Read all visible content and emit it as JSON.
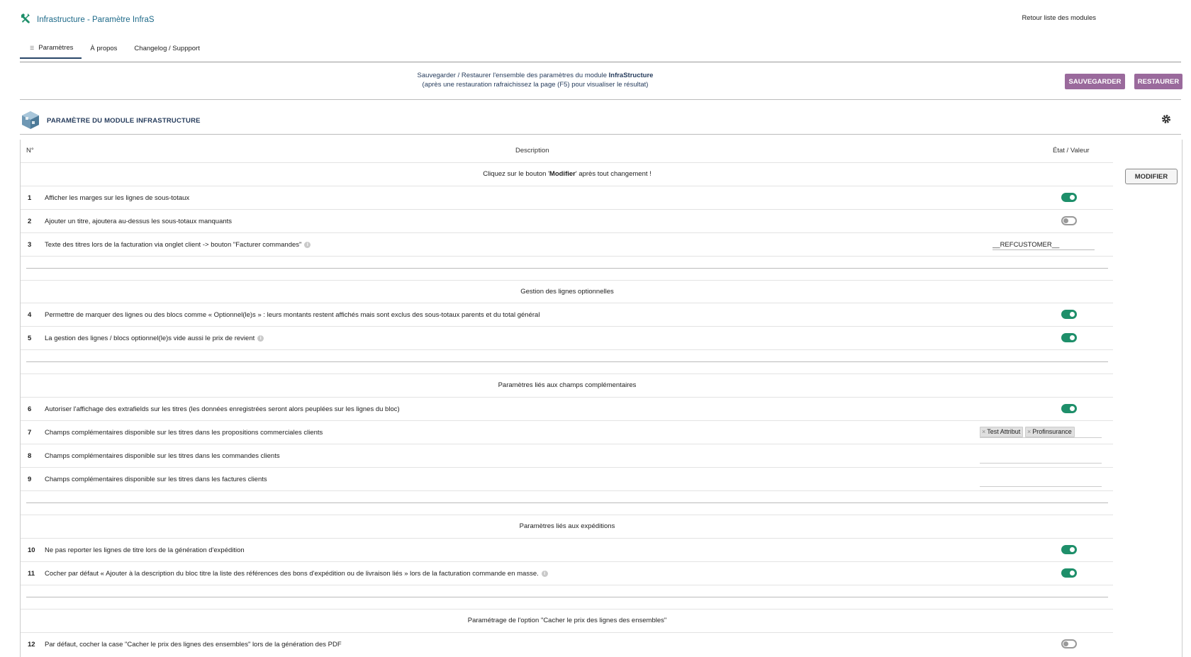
{
  "header": {
    "title": "Infrastructure - Paramètre InfraS",
    "back_link": "Retour liste des modules"
  },
  "tabs": [
    {
      "label": "Paramètres",
      "active": true
    },
    {
      "label": "À propos",
      "active": false
    },
    {
      "label": "Changelog / Suppport",
      "active": false
    }
  ],
  "backup": {
    "line1_prefix": "Sauvegarder / Restaurer l'ensemble des paramètres du module ",
    "module_name": "InfraStructure",
    "line2": "(après une restauration rafraichissez la page (F5) pour visualiser le résultat)",
    "save_label": "SAUVEGARDER",
    "restore_label": "RESTAURER"
  },
  "module": {
    "title": "PARAMÈTRE DU MODULE INFRASTRUCTURE"
  },
  "table": {
    "col_num": "N°",
    "col_desc": "Description",
    "col_value": "État / Valeur",
    "notice_prefix": "Cliquez sur le bouton '",
    "notice_bold": "Modifier",
    "notice_suffix": "' après tout changement !",
    "modify_label": "MODIFIER"
  },
  "sections": {
    "s2": "Gestion des lignes optionnelles",
    "s3": "Paramètres liés aux champs complémentaires",
    "s4": "Paramètres liés aux expéditions",
    "s5": "Paramétrage de l'option \"Cacher le prix des lignes des ensembles\""
  },
  "rows": {
    "r1": {
      "num": "1",
      "desc": "Afficher les marges sur les lignes de sous-totaux",
      "on": true
    },
    "r2": {
      "num": "2",
      "desc": "Ajouter un titre, ajoutera au-dessus les sous-totaux manquants",
      "on": false
    },
    "r3": {
      "num": "3",
      "desc": "Texte des titres lors de la facturation via onglet client -> bouton \"Facturer commandes\"",
      "value": "__REFCUSTOMER__"
    },
    "r4": {
      "num": "4",
      "desc": "Permettre de marquer des lignes ou des blocs comme « Optionnel(le)s » : leurs montants restent affichés mais sont exclus des sous-totaux parents et du total général",
      "on": true
    },
    "r5": {
      "num": "5",
      "desc": "La gestion des lignes / blocs optionnel(le)s vide aussi le prix de revient",
      "on": true
    },
    "r6": {
      "num": "6",
      "desc": "Autoriser l'affichage des extrafields sur les titres (les données enregistrées seront alors peuplées sur les lignes du bloc)",
      "on": true
    },
    "r7": {
      "num": "7",
      "desc": "Champs complémentaires disponible sur les titres dans les propositions commerciales clients",
      "tags": [
        "Test Attribut",
        "Profinsurance"
      ]
    },
    "r8": {
      "num": "8",
      "desc": "Champs complémentaires disponible sur les titres dans les commandes clients"
    },
    "r9": {
      "num": "9",
      "desc": "Champs complémentaires disponible sur les titres dans les factures clients"
    },
    "r10": {
      "num": "10",
      "desc": "Ne pas reporter les lignes de titre lors de la génération d'expédition",
      "on": true
    },
    "r11": {
      "num": "11",
      "desc": "Cocher par défaut « Ajouter à la description du bloc titre la liste des références des bons d'expédition ou de livraison liés » lors de la facturation commande en masse.",
      "on": true
    },
    "r12": {
      "num": "12",
      "desc": "Par défaut, cocher la case \"Cacher le prix des lignes des ensembles\" lors de la génération des PDF",
      "on": false
    }
  },
  "colors": {
    "accent_teal": "#1e8f6a",
    "button_purple": "#9a6a9c",
    "title_blue": "#1e6a89"
  }
}
